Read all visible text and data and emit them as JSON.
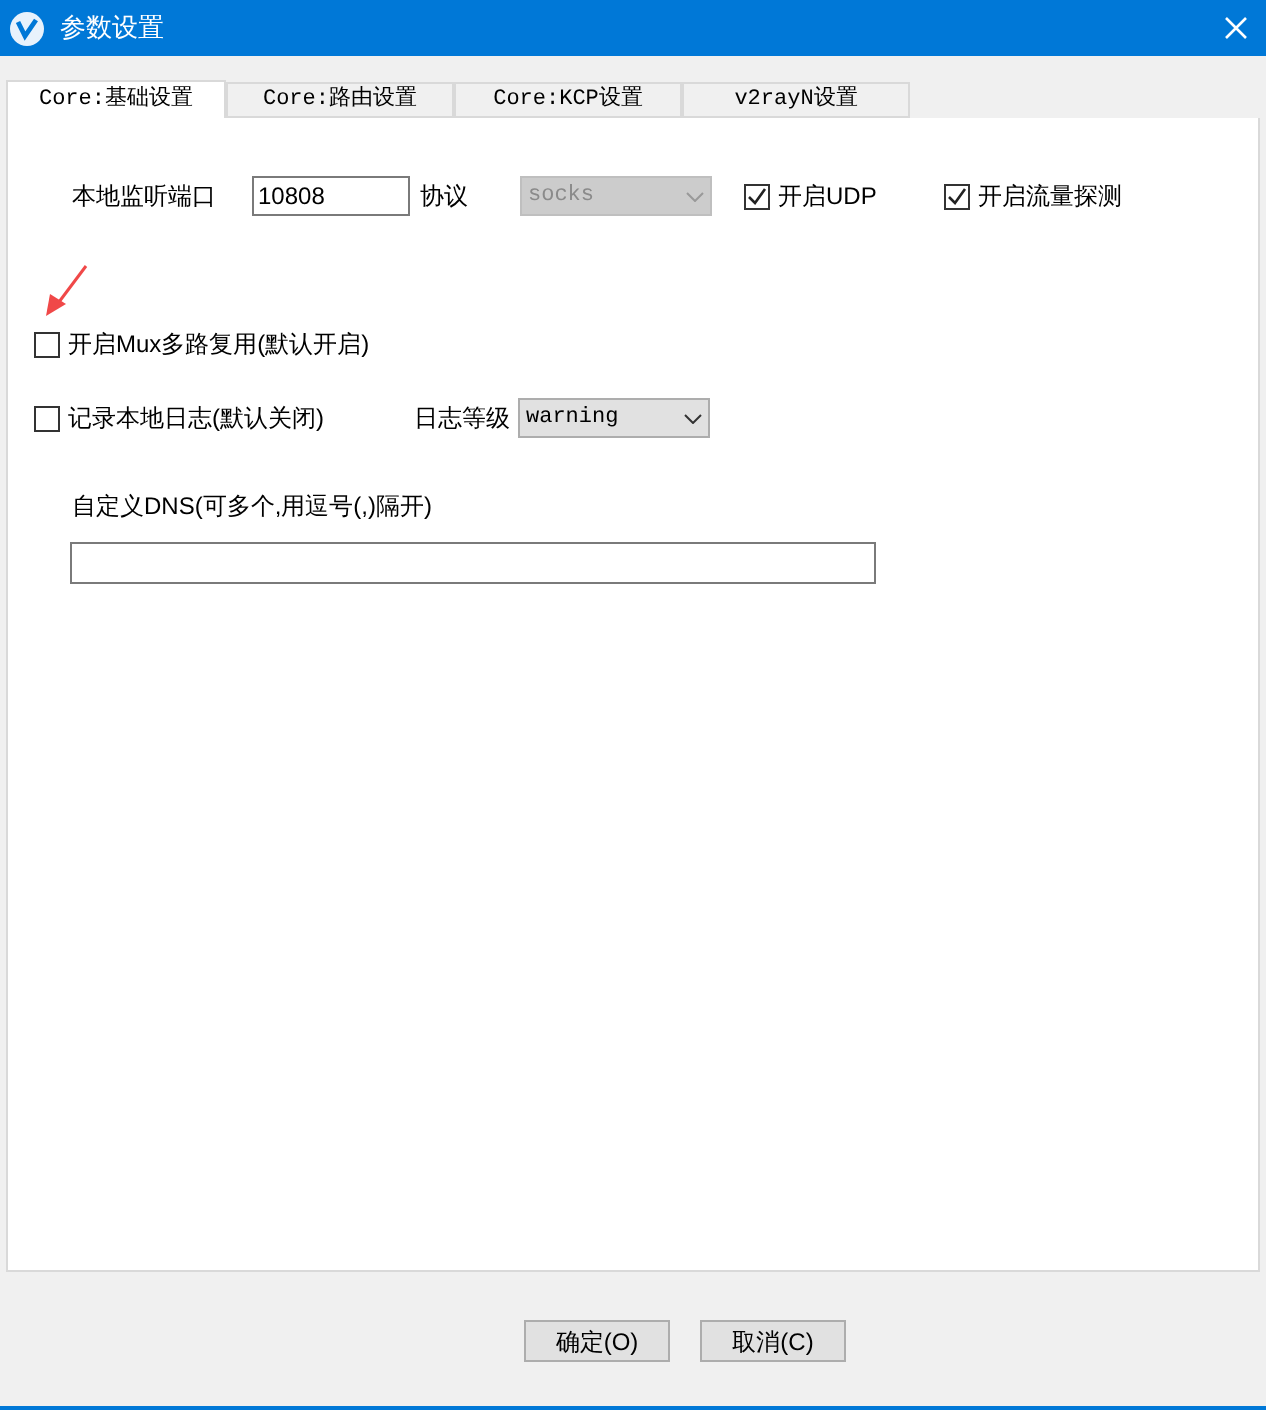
{
  "window": {
    "title": "参数设置"
  },
  "tabs": [
    {
      "label": "Core:基础设置",
      "selected": true
    },
    {
      "label": "Core:路由设置",
      "selected": false
    },
    {
      "label": "Core:KCP设置",
      "selected": false
    },
    {
      "label": "v2rayN设置",
      "selected": false
    }
  ],
  "port": {
    "label": "本地监听端口",
    "value": "10808"
  },
  "protocol": {
    "label": "协议",
    "value": "socks",
    "disabled": true
  },
  "udp": {
    "label": "开启UDP",
    "checked": true
  },
  "sniffing": {
    "label": "开启流量探测",
    "checked": true
  },
  "mux": {
    "label": "开启Mux多路复用(默认开启)",
    "checked": false
  },
  "log": {
    "label": "记录本地日志(默认关闭)",
    "checked": false
  },
  "log_level": {
    "label": "日志等级",
    "value": "warning",
    "disabled": false
  },
  "dns": {
    "label": "自定义DNS(可多个,用逗号(,)隔开)"
  },
  "buttons": [
    "确定(O)",
    "取消(C)"
  ]
}
